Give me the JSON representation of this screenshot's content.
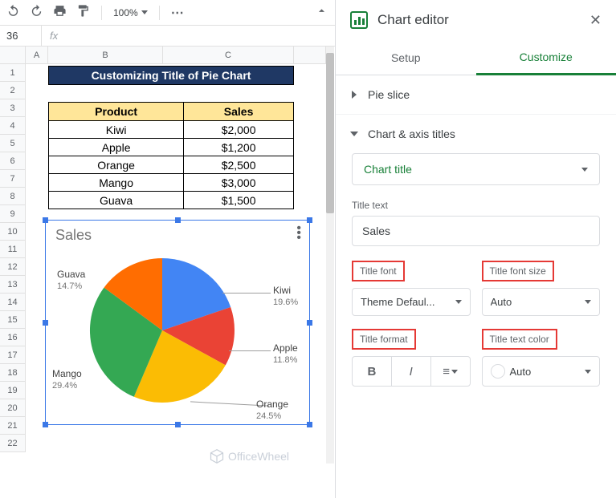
{
  "toolbar": {
    "zoom": "100%"
  },
  "formula_bar": {
    "cell_ref": "36",
    "fx": "fx"
  },
  "columns": [
    "A",
    "B",
    "C"
  ],
  "rows": [
    "1",
    "2",
    "3",
    "4",
    "5",
    "6",
    "7",
    "8",
    "9",
    "10",
    "11",
    "12",
    "13",
    "14",
    "15",
    "16",
    "17",
    "18",
    "19",
    "20",
    "21",
    "22"
  ],
  "banner": "Customizing Title of Pie Chart",
  "table": {
    "headers": [
      "Product",
      "Sales"
    ],
    "rows": [
      [
        "Kiwi",
        "$2,000"
      ],
      [
        "Apple",
        "$1,200"
      ],
      [
        "Orange",
        "$2,500"
      ],
      [
        "Mango",
        "$3,000"
      ],
      [
        "Guava",
        "$1,500"
      ]
    ]
  },
  "chart": {
    "title": "Sales",
    "labels": {
      "kiwi": {
        "name": "Kiwi",
        "pct": "19.6%"
      },
      "apple": {
        "name": "Apple",
        "pct": "11.8%"
      },
      "orange": {
        "name": "Orange",
        "pct": "24.5%"
      },
      "mango": {
        "name": "Mango",
        "pct": "29.4%"
      },
      "guava": {
        "name": "Guava",
        "pct": "14.7%"
      }
    }
  },
  "chart_data": {
    "type": "pie",
    "title": "Sales",
    "categories": [
      "Kiwi",
      "Apple",
      "Orange",
      "Mango",
      "Guava"
    ],
    "values": [
      2000,
      1200,
      2500,
      3000,
      1500
    ],
    "percentages": [
      19.6,
      11.8,
      24.5,
      29.4,
      14.7
    ],
    "colors": [
      "#4285f4",
      "#ea4335",
      "#fbbc04",
      "#34a853",
      "#ff6d01"
    ]
  },
  "editor": {
    "title": "Chart editor",
    "tabs": {
      "setup": "Setup",
      "customize": "Customize"
    },
    "sections": {
      "pie_slice": "Pie slice",
      "chart_axis": "Chart & axis titles"
    },
    "dropdown": "Chart title",
    "title_text_label": "Title text",
    "title_text_value": "Sales",
    "labels": {
      "font": "Title font",
      "font_size": "Title font size",
      "format": "Title format",
      "text_color": "Title text color"
    },
    "font_value": "Theme Defaul...",
    "font_size_value": "Auto",
    "color_value": "Auto"
  },
  "watermark": "OfficeWheel"
}
